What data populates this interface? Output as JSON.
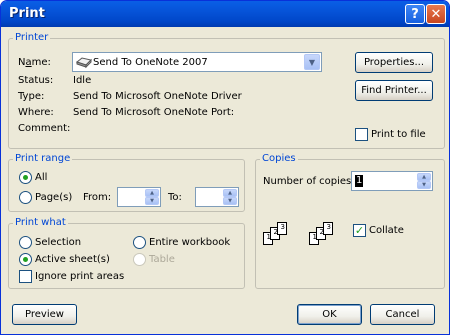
{
  "window": {
    "title": "Print"
  },
  "printer": {
    "legend": "Printer",
    "name_label": "Name:",
    "name_value": "Send To OneNote 2007",
    "status_label": "Status:",
    "status_value": "Idle",
    "type_label": "Type:",
    "type_value": "Send To Microsoft OneNote Driver",
    "where_label": "Where:",
    "where_value": "Send To Microsoft OneNote Port:",
    "comment_label": "Comment:",
    "comment_value": "",
    "properties_button": "Properties...",
    "find_printer_button": "Find Printer...",
    "print_to_file_label": "Print to file",
    "print_to_file_checked": false
  },
  "print_range": {
    "legend": "Print range",
    "all_label": "All",
    "pages_label": "Page(s)",
    "from_label": "From:",
    "to_label": "To:",
    "from_value": "",
    "to_value": "",
    "selected": "All"
  },
  "copies": {
    "legend": "Copies",
    "number_label": "Number of copies:",
    "number_value": "1",
    "collate_label": "Collate",
    "collate_checked": true
  },
  "print_what": {
    "legend": "Print what",
    "selection_label": "Selection",
    "entire_workbook_label": "Entire workbook",
    "active_sheets_label": "Active sheet(s)",
    "table_label": "Table",
    "ignore_print_areas_label": "Ignore print areas",
    "selected": "Active sheet(s)"
  },
  "footer": {
    "preview_button": "Preview",
    "ok_button": "OK",
    "cancel_button": "Cancel"
  },
  "colors": {
    "accent": "#0046d5",
    "titlebar": "#0653d8",
    "dialog_bg": "#ece9d8"
  },
  "icons": {
    "printer_icon": "printer-icon",
    "help": "help-icon",
    "close": "close-icon"
  }
}
